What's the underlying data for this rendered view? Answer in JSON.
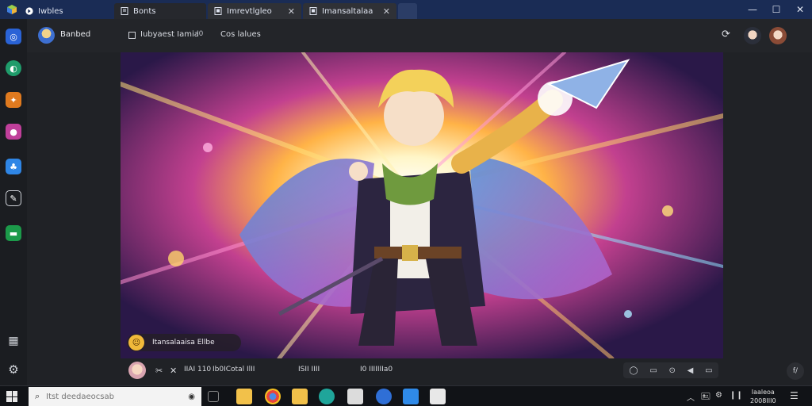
{
  "titlebar": {
    "tabs": [
      {
        "label": "Iwbles",
        "icon": "app-logo-icon"
      },
      {
        "label": "Bonts",
        "icon": "document-icon",
        "active": true
      },
      {
        "label": "Imrevtlgleo",
        "icon": "page-icon"
      },
      {
        "label": "Imansaltalaa",
        "icon": "page-icon"
      }
    ],
    "close_glyph": "✕",
    "window_controls": {
      "minimize": "—",
      "maximize": "☐",
      "close": "✕"
    }
  },
  "sidebar": {
    "items": [
      {
        "name": "blue-circle-app-icon",
        "color": "#2a63d6",
        "glyph": "◎"
      },
      {
        "name": "browser-app-icon",
        "color": "#1f9c6b",
        "glyph": "◐"
      },
      {
        "name": "puzzle-app-icon",
        "color": "#e07a1f",
        "glyph": "✦"
      },
      {
        "name": "pink-app-icon",
        "color": "#c03f9a",
        "glyph": "●"
      },
      {
        "name": "people-app-icon",
        "color": "#2f86e6",
        "glyph": "♣"
      },
      {
        "name": "pen-app-icon",
        "color": "#1b1d21",
        "glyph": "✎"
      },
      {
        "name": "green-app-icon",
        "color": "#1c9a4a",
        "glyph": "▬"
      }
    ],
    "bottom": [
      {
        "name": "calendar-icon",
        "glyph": "▦"
      },
      {
        "name": "settings-gear-icon",
        "glyph": "⚙"
      }
    ]
  },
  "toolbar": {
    "user_name": "Banbed",
    "checkbox_label": "Iubyaest Iamia",
    "small_tag": "I0",
    "link_label": "Cos lalues",
    "share_glyph": "⟳"
  },
  "image": {
    "caption": "Itansalaaisa  Ellbe",
    "caption_badge": "☺"
  },
  "player": {
    "items": [
      {
        "text": "✂"
      },
      {
        "text": "✕"
      },
      {
        "text": "IIAI 110"
      },
      {
        "text": "Ib0ICotal IlII"
      },
      {
        "text": "ISII IIII"
      },
      {
        "text": "I0 IIIIIIIa0"
      }
    ],
    "controls": [
      "◯",
      "▭",
      "⊙",
      "◀",
      "▭"
    ],
    "float_label": "f/"
  },
  "taskbar": {
    "search_placeholder": "Itst deedaeocsab",
    "tray_up": "︿",
    "tray_icons": [
      "🖭",
      "⚙",
      "❙❙"
    ],
    "clock_time": "Iaaleoa",
    "clock_date": "2008III0",
    "notification_glyph": "☰"
  }
}
